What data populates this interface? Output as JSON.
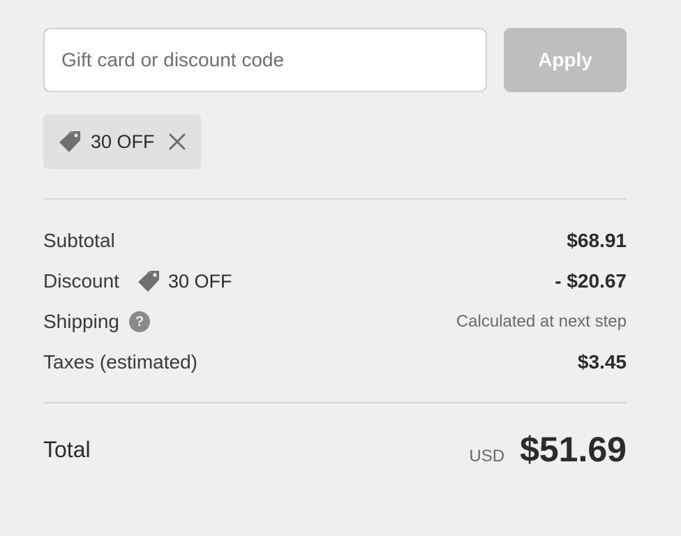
{
  "discount_form": {
    "input_value": "",
    "input_placeholder": "Gift card or discount code",
    "apply_label": "Apply"
  },
  "applied_code": {
    "label": "30 OFF",
    "icon": "tag-icon",
    "remove_icon": "close-icon"
  },
  "summary": {
    "subtotal": {
      "label": "Subtotal",
      "value": "$68.91"
    },
    "discount": {
      "label": "Discount",
      "code": "30 OFF",
      "value": "- $20.67"
    },
    "shipping": {
      "label": "Shipping",
      "help_icon": "question-icon",
      "help_glyph": "?",
      "value": "Calculated at next step"
    },
    "taxes": {
      "label": "Taxes (estimated)",
      "value": "$3.45"
    }
  },
  "total": {
    "label": "Total",
    "currency": "USD",
    "amount": "$51.69"
  },
  "colors": {
    "background": "#efefef",
    "apply_button": "#bebebe",
    "chip_background": "#e1e1e1",
    "icon_gray": "#707070"
  }
}
